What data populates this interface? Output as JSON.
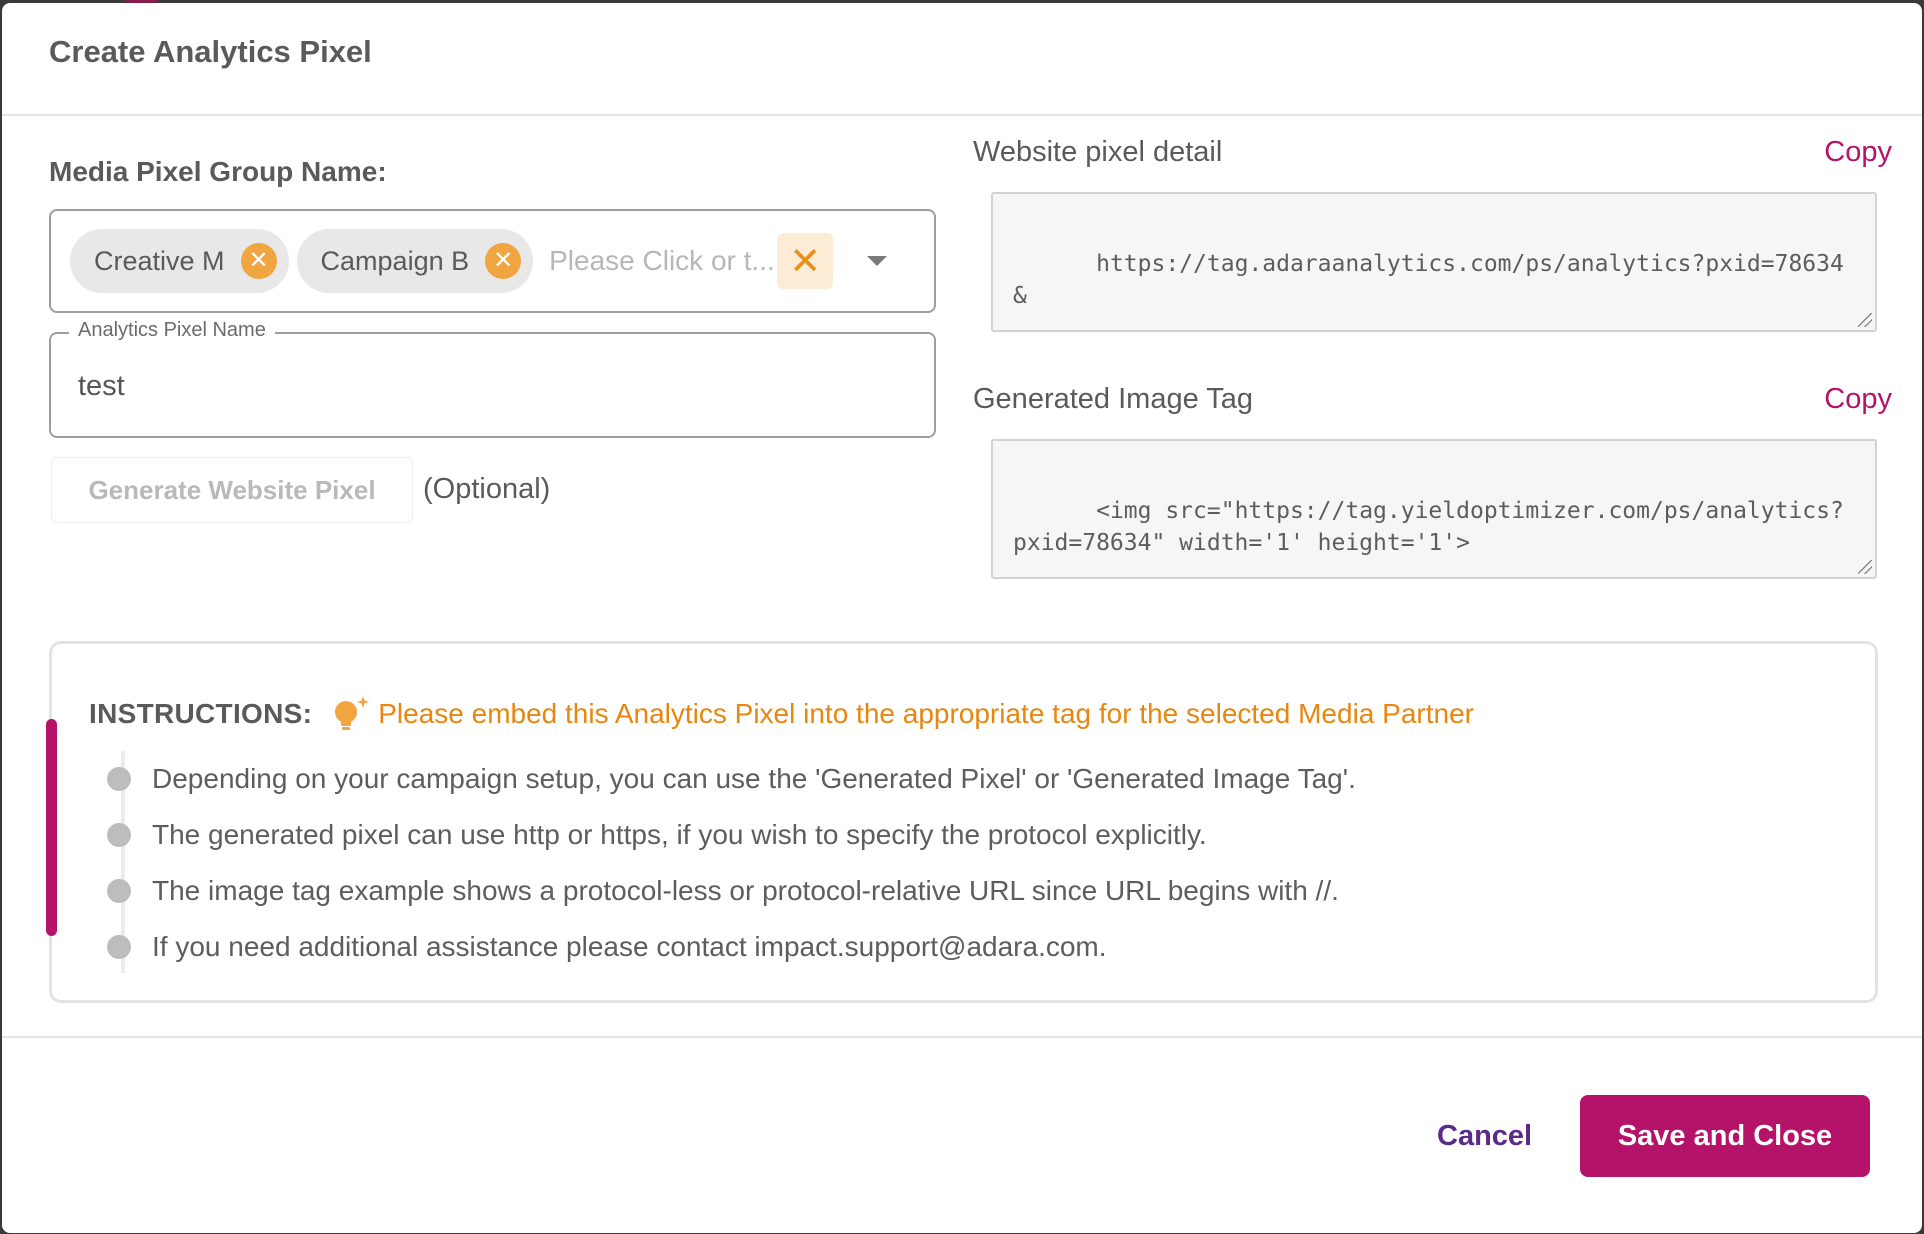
{
  "dialog": {
    "title": "Create Analytics Pixel"
  },
  "media_group": {
    "label": "Media Pixel Group Name:",
    "chips": [
      "Creative M",
      "Campaign B"
    ],
    "placeholder": "Please Click or t..."
  },
  "pixel_name": {
    "legend": "Analytics Pixel Name",
    "value": "test"
  },
  "generate": {
    "label": "Generate Website Pixel",
    "optional": "(Optional)"
  },
  "website_pixel": {
    "label": "Website pixel detail",
    "copy": "Copy",
    "value": "https://tag.adaraanalytics.com/ps/analytics?pxid=78634&"
  },
  "image_tag": {
    "label": "Generated Image Tag",
    "copy": "Copy",
    "value": "<img src=\"https://tag.yieldoptimizer.com/ps/analytics?pxid=78634\" width='1' height='1'>"
  },
  "instructions": {
    "label": "INSTRUCTIONS:",
    "message": "Please embed this Analytics Pixel into the appropriate tag for the selected Media Partner",
    "items": [
      "Depending on your campaign setup, you can use the 'Generated Pixel' or 'Generated Image Tag'.",
      "The generated pixel can use http or https, if you wish to specify the protocol explicitly.",
      "The image tag example shows a protocol-less or protocol-relative URL since URL begins with //.",
      "If you need additional assistance please contact impact.support@adara.com."
    ]
  },
  "footer": {
    "cancel": "Cancel",
    "save": "Save and Close"
  },
  "colors": {
    "brand": "#b5136a",
    "accent_orange": "#e8860f",
    "cancel_text": "#5b2a86"
  },
  "icons": {
    "chip_remove": "close-circle-icon",
    "clear": "close-icon",
    "dropdown": "chevron-down-icon",
    "tip": "lightbulb-icon"
  }
}
